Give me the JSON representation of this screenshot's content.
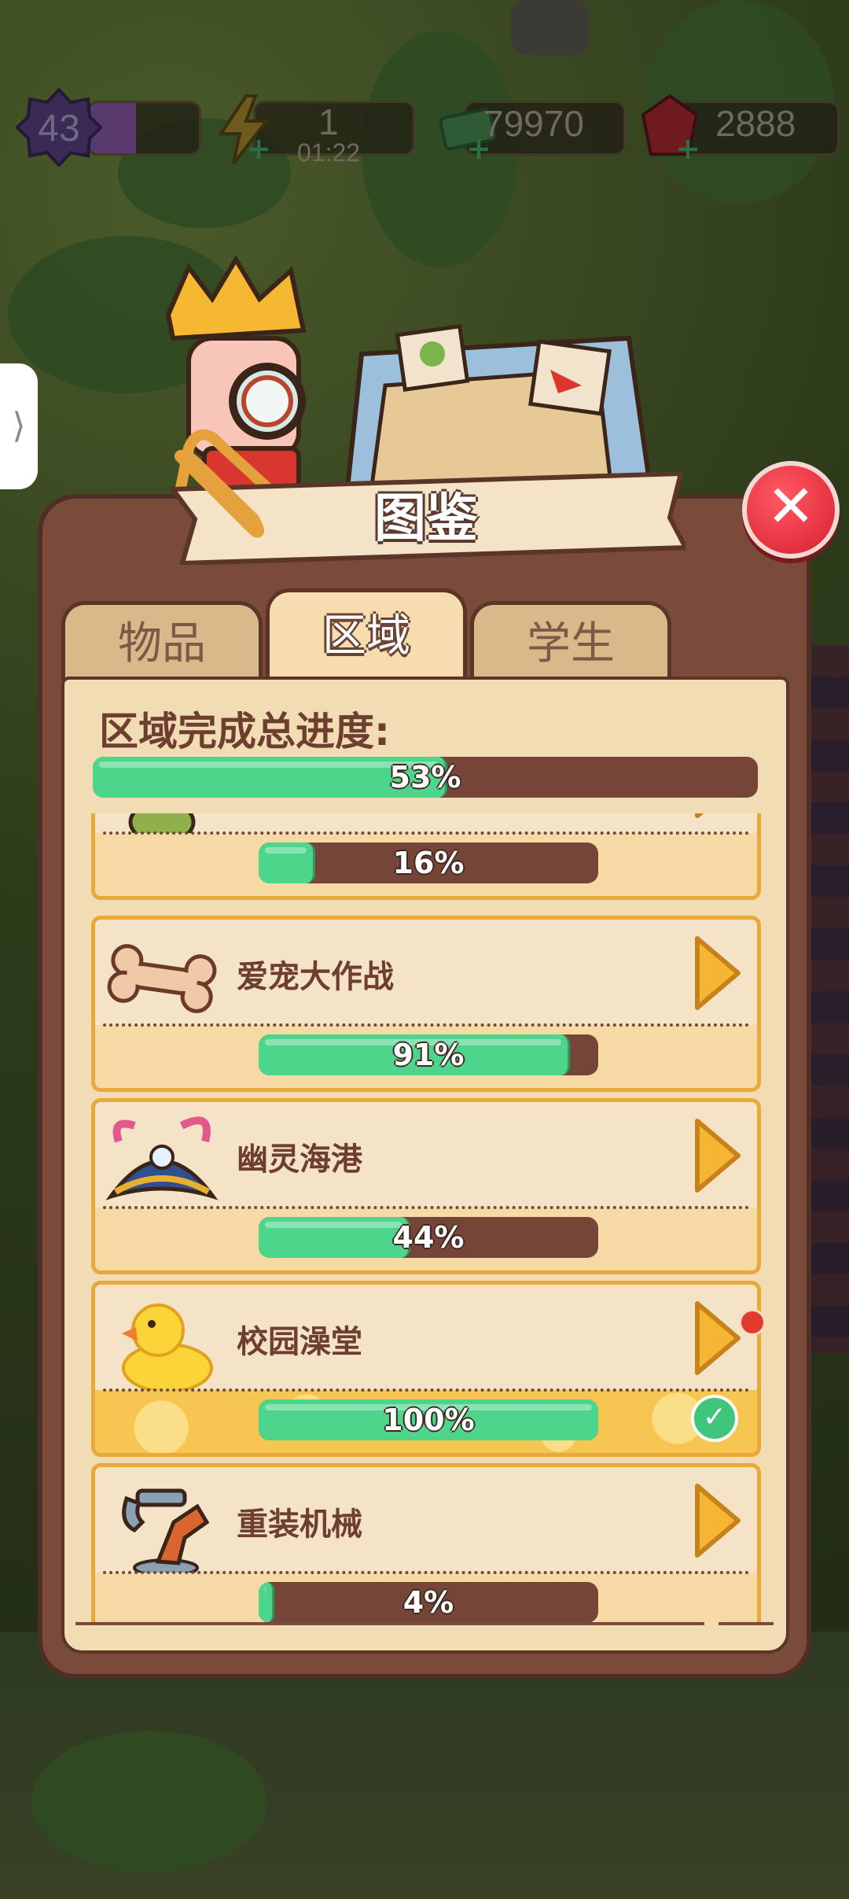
{
  "hud": {
    "level": "43",
    "energy": "1",
    "energy_timer": "01:22",
    "cash": "79970",
    "gems": "2888"
  },
  "side_tab": {
    "label": "⟩"
  },
  "panel": {
    "title": "图鉴",
    "close_label": "✕",
    "tabs": [
      {
        "label": "物品",
        "active": false
      },
      {
        "label": "区域",
        "active": true
      },
      {
        "label": "学生",
        "active": false
      }
    ],
    "total_progress_label": "区域完成总进度:",
    "total_progress": {
      "value": 53,
      "text": "53%"
    }
  },
  "areas": [
    {
      "name": "",
      "icon": "green-item-icon",
      "progress": 16,
      "text": "16%",
      "done": false
    },
    {
      "name": "爱宠大作战",
      "icon": "bone-icon",
      "progress": 91,
      "text": "91%",
      "done": false
    },
    {
      "name": "幽灵海港",
      "icon": "pirate-hat-icon",
      "progress": 44,
      "text": "44%",
      "done": false
    },
    {
      "name": "校园澡堂",
      "icon": "rubber-duck-icon",
      "progress": 100,
      "text": "100%",
      "done": true
    },
    {
      "name": "重装机械",
      "icon": "robot-arm-icon",
      "progress": 4,
      "text": "4%",
      "done": false
    }
  ],
  "colors": {
    "progress_fill": "#4dd58c",
    "progress_track": "#754538",
    "panel_bg": "#7a4a3b",
    "content_bg": "#f2dcb3",
    "card_border": "#e8a83a",
    "close_red": "#d81f2f"
  }
}
